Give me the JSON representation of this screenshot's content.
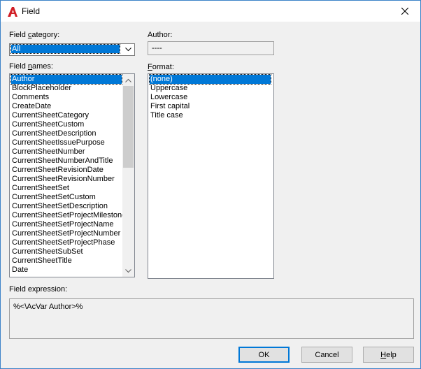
{
  "window": {
    "title": "Field",
    "app_icon": "autocad-a-icon",
    "close_icon": "close-icon"
  },
  "field_category": {
    "label_prefix": "Field ",
    "label_underlined": "c",
    "label_suffix": "ategory:",
    "value": "All"
  },
  "author": {
    "label": "Author:",
    "value": "----"
  },
  "field_names": {
    "label_prefix": "Field ",
    "label_underlined": "n",
    "label_suffix": "ames:",
    "items": [
      "Author",
      "BlockPlaceholder",
      "Comments",
      "CreateDate",
      "CurrentSheetCategory",
      "CurrentSheetCustom",
      "CurrentSheetDescription",
      "CurrentSheetIssuePurpose",
      "CurrentSheetNumber",
      "CurrentSheetNumberAndTitle",
      "CurrentSheetRevisionDate",
      "CurrentSheetRevisionNumber",
      "CurrentSheetSet",
      "CurrentSheetSetCustom",
      "CurrentSheetSetDescription",
      "CurrentSheetSetProjectMilestone",
      "CurrentSheetSetProjectName",
      "CurrentSheetSetProjectNumber",
      "CurrentSheetSetProjectPhase",
      "CurrentSheetSubSet",
      "CurrentSheetTitle",
      "Date"
    ],
    "selected_index": 0
  },
  "format": {
    "label_prefix": "",
    "label_underlined": "F",
    "label_suffix": "ormat:",
    "items": [
      "(none)",
      "Uppercase",
      "Lowercase",
      "First capital",
      "Title case"
    ],
    "selected_index": 0
  },
  "field_expression": {
    "label": "Field expression:",
    "value": "%<\\AcVar Author>%"
  },
  "buttons": {
    "ok": "OK",
    "cancel": "Cancel",
    "help_underlined": "H",
    "help_suffix": "elp"
  }
}
